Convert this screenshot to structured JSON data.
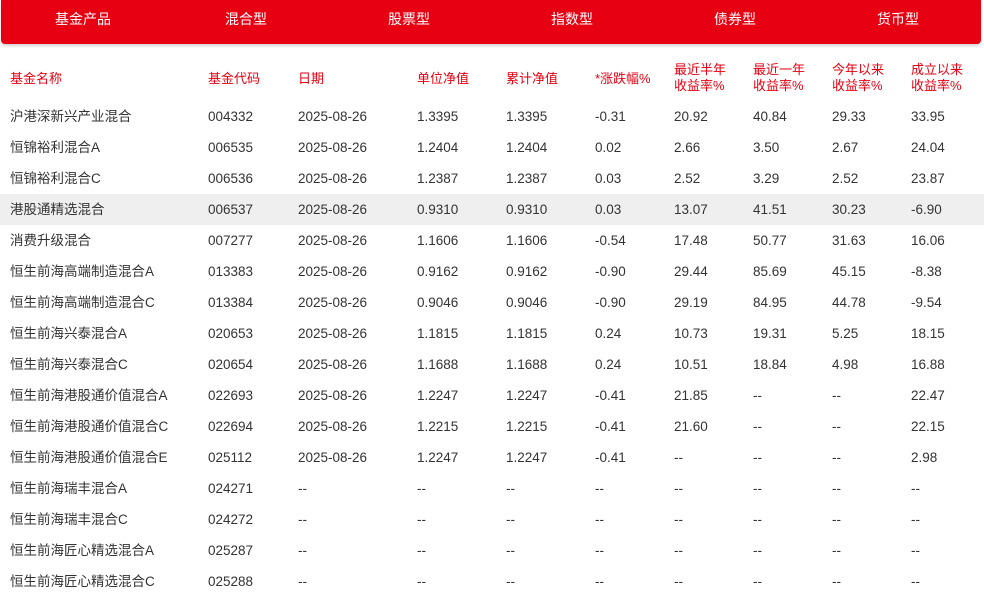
{
  "tabs": [
    {
      "label": "基金产品"
    },
    {
      "label": "混合型"
    },
    {
      "label": "股票型"
    },
    {
      "label": "指数型"
    },
    {
      "label": "债券型"
    },
    {
      "label": "货币型"
    }
  ],
  "table": {
    "headers": [
      {
        "line1": "基金名称",
        "line2": ""
      },
      {
        "line1": "基金代码",
        "line2": ""
      },
      {
        "line1": "日期",
        "line2": ""
      },
      {
        "line1": "单位净值",
        "line2": ""
      },
      {
        "line1": "累计净值",
        "line2": ""
      },
      {
        "line1": "*涨跌幅%",
        "line2": ""
      },
      {
        "line1": "最近半年",
        "line2": "收益率%"
      },
      {
        "line1": "最近一年",
        "line2": "收益率%"
      },
      {
        "line1": "今年以来",
        "line2": "收益率%"
      },
      {
        "line1": "成立以来",
        "line2": "收益率%"
      }
    ],
    "rows": [
      [
        "沪港深新兴产业混合",
        "004332",
        "2025-08-26",
        "1.3395",
        "1.3395",
        "-0.31",
        "20.92",
        "40.84",
        "29.33",
        "33.95"
      ],
      [
        "恒锦裕利混合A",
        "006535",
        "2025-08-26",
        "1.2404",
        "1.2404",
        "0.02",
        "2.66",
        "3.50",
        "2.67",
        "24.04"
      ],
      [
        "恒锦裕利混合C",
        "006536",
        "2025-08-26",
        "1.2387",
        "1.2387",
        "0.03",
        "2.52",
        "3.29",
        "2.52",
        "23.87"
      ],
      [
        "港股通精选混合",
        "006537",
        "2025-08-26",
        "0.9310",
        "0.9310",
        "0.03",
        "13.07",
        "41.51",
        "30.23",
        "-6.90"
      ],
      [
        "消费升级混合",
        "007277",
        "2025-08-26",
        "1.1606",
        "1.1606",
        "-0.54",
        "17.48",
        "50.77",
        "31.63",
        "16.06"
      ],
      [
        "恒生前海高端制造混合A",
        "013383",
        "2025-08-26",
        "0.9162",
        "0.9162",
        "-0.90",
        "29.44",
        "85.69",
        "45.15",
        "-8.38"
      ],
      [
        "恒生前海高端制造混合C",
        "013384",
        "2025-08-26",
        "0.9046",
        "0.9046",
        "-0.90",
        "29.19",
        "84.95",
        "44.78",
        "-9.54"
      ],
      [
        "恒生前海兴泰混合A",
        "020653",
        "2025-08-26",
        "1.1815",
        "1.1815",
        "0.24",
        "10.73",
        "19.31",
        "5.25",
        "18.15"
      ],
      [
        "恒生前海兴泰混合C",
        "020654",
        "2025-08-26",
        "1.1688",
        "1.1688",
        "0.24",
        "10.51",
        "18.84",
        "4.98",
        "16.88"
      ],
      [
        "恒生前海港股通价值混合A",
        "022693",
        "2025-08-26",
        "1.2247",
        "1.2247",
        "-0.41",
        "21.85",
        "--",
        "--",
        "22.47"
      ],
      [
        "恒生前海港股通价值混合C",
        "022694",
        "2025-08-26",
        "1.2215",
        "1.2215",
        "-0.41",
        "21.60",
        "--",
        "--",
        "22.15"
      ],
      [
        "恒生前海港股通价值混合E",
        "025112",
        "2025-08-26",
        "1.2247",
        "1.2247",
        "-0.41",
        "--",
        "--",
        "--",
        "2.98"
      ],
      [
        "恒生前海瑞丰混合A",
        "024271",
        "--",
        "--",
        "--",
        "--",
        "--",
        "--",
        "--",
        "--"
      ],
      [
        "恒生前海瑞丰混合C",
        "024272",
        "--",
        "--",
        "--",
        "--",
        "--",
        "--",
        "--",
        "--"
      ],
      [
        "恒生前海匠心精选混合A",
        "025287",
        "--",
        "--",
        "--",
        "--",
        "--",
        "--",
        "--",
        "--"
      ],
      [
        "恒生前海匠心精选混合C",
        "025288",
        "--",
        "--",
        "--",
        "--",
        "--",
        "--",
        "--",
        "--"
      ]
    ]
  },
  "colors": {
    "brand_red": "#e60012",
    "highlight_row": "#efefef",
    "text": "#333333"
  }
}
